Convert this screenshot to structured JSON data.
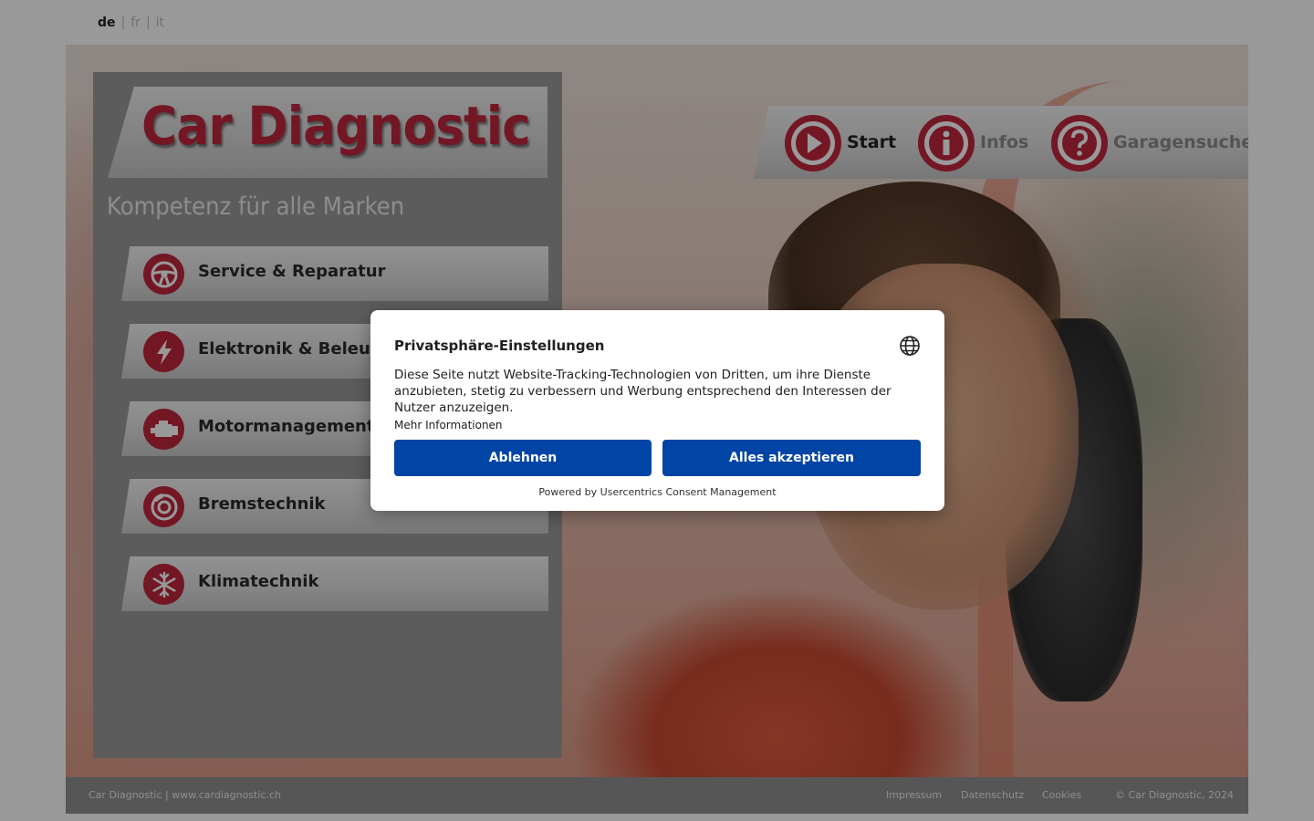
{
  "languages": {
    "items": [
      {
        "code": "de",
        "active": true
      },
      {
        "code": "fr",
        "active": false
      },
      {
        "code": "it",
        "active": false
      }
    ],
    "separator": "|"
  },
  "brand": {
    "logo": "Car Diagnostic",
    "tagline": "Kompetenz für alle Marken",
    "accent_color": "#c0273f"
  },
  "services": [
    {
      "label": "Service & Reparatur",
      "icon": "steering-wheel-icon"
    },
    {
      "label": "Elektronik & Beleuchtung",
      "icon": "lightning-icon"
    },
    {
      "label": "Motormanagement",
      "icon": "engine-icon"
    },
    {
      "label": "Bremstechnik",
      "icon": "brake-disc-icon"
    },
    {
      "label": "Klimatechnik",
      "icon": "snowflake-icon"
    }
  ],
  "nav": [
    {
      "label": "Start",
      "icon": "play-icon",
      "active": true
    },
    {
      "label": "Infos",
      "icon": "info-icon",
      "active": false
    },
    {
      "label": "Garagensuche",
      "icon": "question-icon",
      "active": false
    }
  ],
  "footer": {
    "left": "Car Diagnostic | www.cardiagnostic.ch",
    "links": [
      "Impressum",
      "Datenschutz",
      "Cookies"
    ],
    "copyright": "© Car Diagnostic, 2024"
  },
  "consent": {
    "title": "Privatsphäre-Einstellungen",
    "text": "Diese Seite nutzt Website-Tracking-Technologien von Dritten, um ihre Dienste anzubieten, stetig zu verbessern und Werbung entsprechend den Interessen der Nutzer anzuzeigen.",
    "more": "Mehr Informationen",
    "deny": "Ablehnen",
    "accept": "Alles akzeptieren",
    "powered_by": "Powered by Usercentrics Consent Management",
    "button_color": "#0045a5"
  }
}
